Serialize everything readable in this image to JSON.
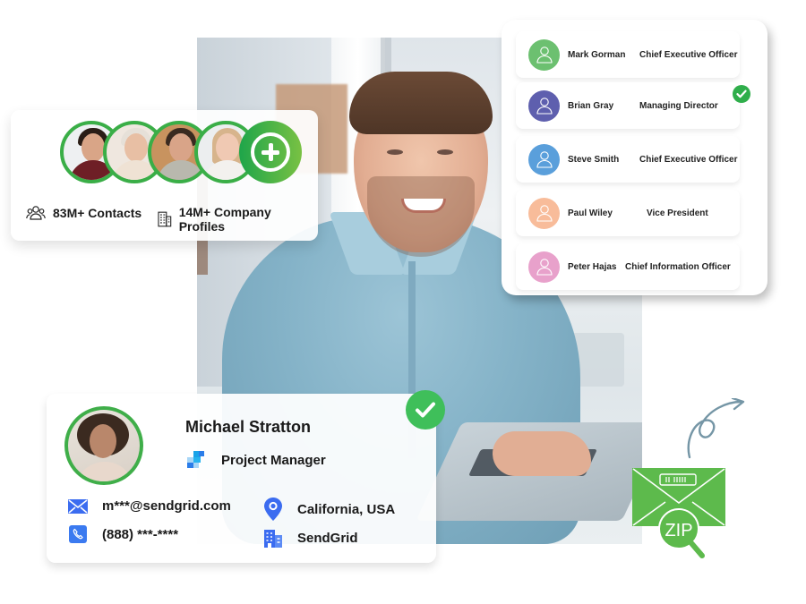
{
  "colors": {
    "brand_green": "#3aae47",
    "check_green": "#2fae4b",
    "zip_green": "#5dba4c",
    "icon_blue": "#3b6cf0",
    "arrow_gray": "#7596a6"
  },
  "stats_card": {
    "avatars": [
      {
        "name": "avatar-young-man"
      },
      {
        "name": "avatar-older-woman"
      },
      {
        "name": "avatar-bearded-man"
      },
      {
        "name": "avatar-blonde-woman"
      }
    ],
    "add_icon": "plus-circle-icon",
    "stats": [
      {
        "icon": "people-group-icon",
        "label": "83M+ Contacts"
      },
      {
        "icon": "building-icon",
        "label": "14M+ Company Profiles"
      }
    ]
  },
  "contacts_list": {
    "rows": [
      {
        "name": "Mark Gorman",
        "title": "Chief Executive Officer",
        "avatar_color": "#6cc070",
        "verified": false
      },
      {
        "name": "Brian Gray",
        "title": "Managing Director",
        "avatar_color": "#5e5fae",
        "verified": true
      },
      {
        "name": "Steve Smith",
        "title": "Chief Executive Officer",
        "avatar_color": "#5a9fdb",
        "verified": false
      },
      {
        "name": "Paul Wiley",
        "title": "Vice President",
        "avatar_color": "#f8bc9a",
        "verified": false
      },
      {
        "name": "Peter Hajas",
        "title": "Chief Information Officer",
        "avatar_color": "#e8a1cb",
        "verified": false
      }
    ]
  },
  "profile_card": {
    "name": "Michael Stratton",
    "role": "Project Manager",
    "email": "m***@sendgrid.com",
    "phone": "(888) ***-****",
    "location": "California, USA",
    "company": "SendGrid",
    "verified": true
  },
  "zip_badge": {
    "label": "ZIP"
  }
}
